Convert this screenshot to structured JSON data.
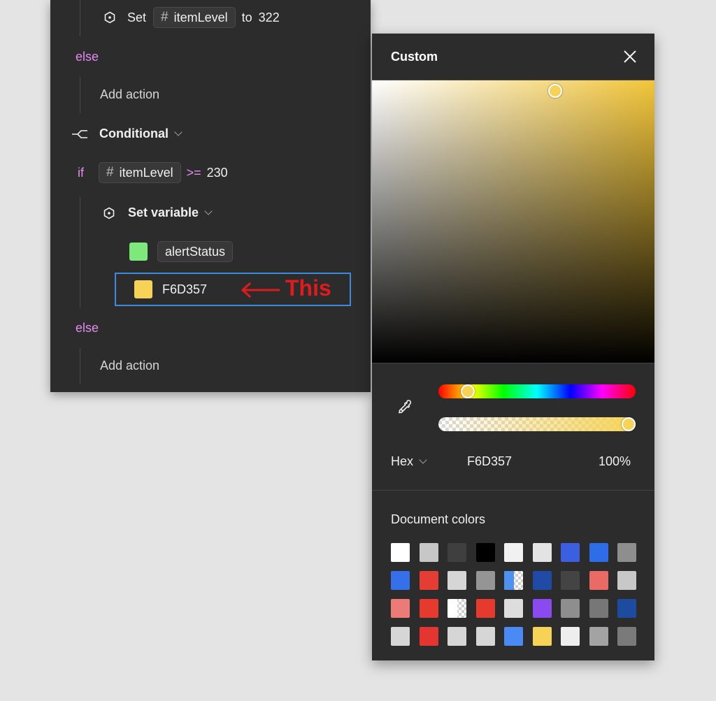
{
  "actions": {
    "top_set": {
      "verb": "Set",
      "variable": "itemLevel",
      "connector": "to",
      "value": "322"
    },
    "else_1": "else",
    "add_action_1": "Add action",
    "conditional": {
      "label": "Conditional"
    },
    "if_row": {
      "keyword": "if",
      "variable": "itemLevel",
      "operator": ">=",
      "value": "230"
    },
    "set_variable": {
      "label": "Set variable"
    },
    "variable_row": {
      "name": "alertStatus",
      "swatch_color": "#7fe87a"
    },
    "color_row": {
      "value": "F6D357",
      "swatch_color": "#f6d357"
    },
    "annotation": {
      "text": "This",
      "color": "#e01b1b"
    },
    "else_2": "else",
    "add_action_2": "Add action"
  },
  "picker": {
    "title": "Custom",
    "base_hue_color": "#f2c53a",
    "selected_color": "#f6d357",
    "format": "Hex",
    "hex": "F6D357",
    "opacity": "100%",
    "document_colors_label": "Document colors",
    "document_colors": [
      "#ffffff",
      "#c7c7c7",
      "#3f3f3f",
      "#000000",
      "#f1f1f1",
      "#e3e3e3",
      "#3b5fe0",
      "#2f6ce8",
      "#8e8e8e",
      "#3570ea",
      "#e53d33",
      "#d6d6d6",
      "#959595",
      "half:#4d92f0",
      "#1f4aa6",
      "#444444",
      "#ea6b66",
      "#c8c8c8",
      "#ec7b78",
      "#e73a2e",
      "half:#ffffff",
      "#e73a2e",
      "#dddddd",
      "#8a4af0",
      "#8e8e8e",
      "#777777",
      "#1d4ba0",
      "#d6d6d6",
      "#e53530",
      "#d6d6d6",
      "#d6d6d6",
      "#4a8af4",
      "#f6d357",
      "#eeeeee",
      "#a3a3a3",
      "#7a7a7a"
    ]
  }
}
